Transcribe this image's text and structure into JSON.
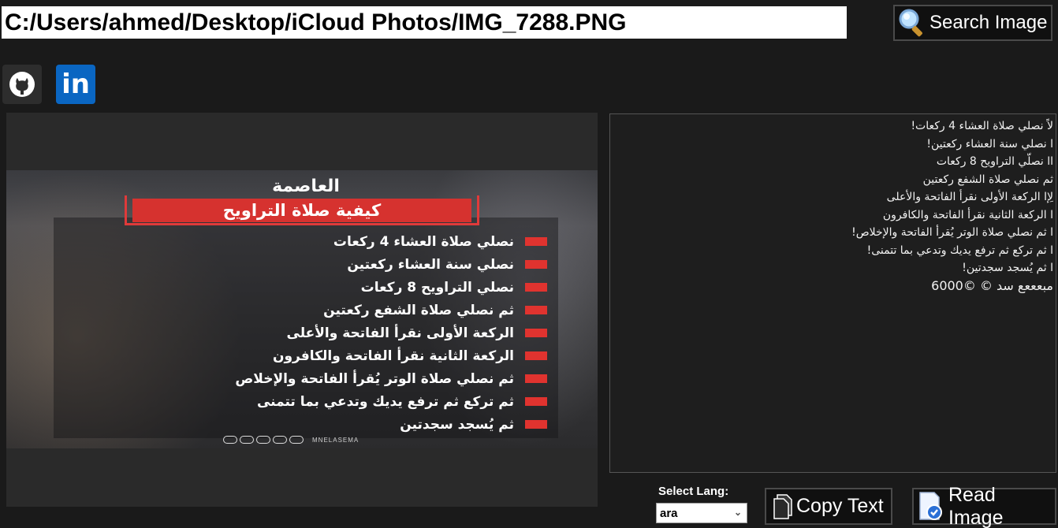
{
  "header": {
    "file_path": "C:/Users/ahmed/Desktop/iCloud Photos/IMG_7288.PNG",
    "search_label": "Search Image"
  },
  "social": {
    "github_icon": "github-icon",
    "linkedin_text": "in"
  },
  "poster": {
    "logo": "العاصمة",
    "title": "كيفية صلاة التراويح",
    "items": [
      "نصلي صلاة العشاء 4 ركعات",
      "نصلي سنة العشاء ركعتين",
      "نصلي التراويح 8 ركعات",
      "ثم نصلي صلاة الشفع ركعتين",
      "الركعة الأولى نقرأ الفاتحة والأعلى",
      "الركعة الثانية نقرأ الفاتحة والكافرون",
      "ثم نصلي صلاة الوتر يُقرأ الفاتحة والإخلاص",
      "ثم تركع ثم ترفع يديك وتدعي بما تتمنى",
      "ثم يُسجد سجدتين"
    ],
    "footer_handle": "MNELASEMA"
  },
  "ocr": {
    "lines": [
      "لاً نصلي صلاة العشاء 4 ركعات!",
      "ا نصلي سنة العشاء ركعتين!",
      "اا نصلّي التراويح 8 ركعات",
      "ثم نصلي صلاة الشفع ركعتين",
      "لِإا الركعة الأولى نقرأ الفاتحة والأعلى",
      "ا الركعة الثانية نقرأ الفاتحة والكافرون",
      "ا ثم نصلي صلاة الوتر يُقرأ الفاتحة والإخلاص!",
      "ا ثم تركع ثم ترفع يديك وتدعي بما تتمنى!",
      "ا ثم يُسجد سجدتين!",
      "مبعععع سد © ©6000"
    ]
  },
  "controls": {
    "lang_label": "Select Lang:",
    "lang_value": "ara",
    "copy_label": "Copy Text",
    "read_label": "Read Image"
  }
}
